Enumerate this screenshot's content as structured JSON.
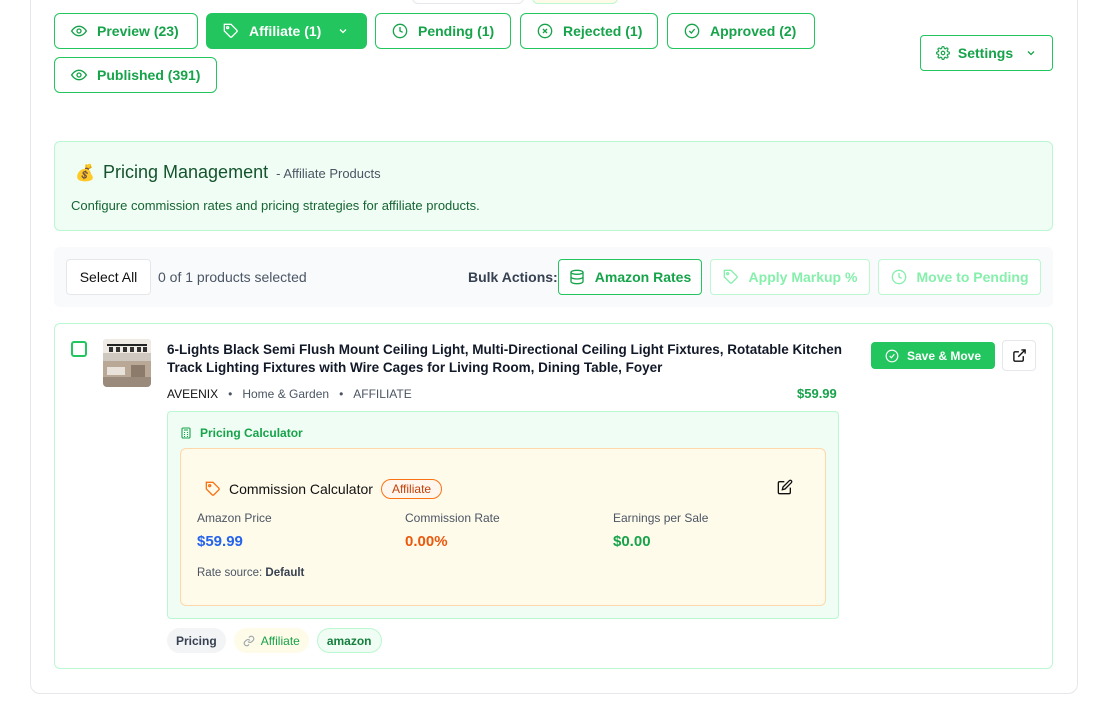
{
  "tabs": [
    {
      "label": "Preview (23)",
      "icon": "eye-icon"
    },
    {
      "label": "Affiliate (1)",
      "icon": "tag-icon"
    },
    {
      "label": "Pending (1)",
      "icon": "clock-icon"
    },
    {
      "label": "Rejected (1)",
      "icon": "x-circle-icon"
    },
    {
      "label": "Approved (2)",
      "icon": "check-circle-icon"
    },
    {
      "label": "Published (391)",
      "icon": "eye-icon"
    }
  ],
  "settings_label": "Settings",
  "pricing": {
    "emoji": "💰",
    "title": "Pricing Management",
    "subtitle": "- Affiliate Products",
    "description": "Configure commission rates and pricing strategies for affiliate products."
  },
  "bulk": {
    "select_all": "Select All",
    "selected_text": "0 of 1 products selected",
    "actions_label": "Bulk Actions:",
    "amazon_rates": "Amazon Rates",
    "apply_markup": "Apply Markup %",
    "move_pending": "Move to Pending"
  },
  "product": {
    "title": "6-Lights Black Semi Flush Mount Ceiling Light, Multi-Directional Ceiling Light Fixtures, Rotatable Kitchen Track Lighting Fixtures with Wire Cages for Living Room, Dining Table, Foyer",
    "brand": "AVEENIX",
    "category": "Home & Garden",
    "type": "AFFILIATE",
    "price": "$59.99",
    "save_label": "Save & Move"
  },
  "calculator": {
    "section_title": "Pricing Calculator",
    "title": "Commission Calculator",
    "badge": "Affiliate",
    "amazon_price_label": "Amazon Price",
    "amazon_price": "$59.99",
    "commission_rate_label": "Commission Rate",
    "commission_rate": "0.00%",
    "earnings_label": "Earnings per Sale",
    "earnings": "$0.00",
    "rate_source_label": "Rate source:",
    "rate_source": "Default"
  },
  "tags": [
    "Pricing",
    "Affiliate",
    "amazon"
  ],
  "colors": {
    "accent": "#22c55e",
    "price_blue": "#2563eb",
    "rate_orange": "#ea580c",
    "earn_green": "#16a34a"
  }
}
